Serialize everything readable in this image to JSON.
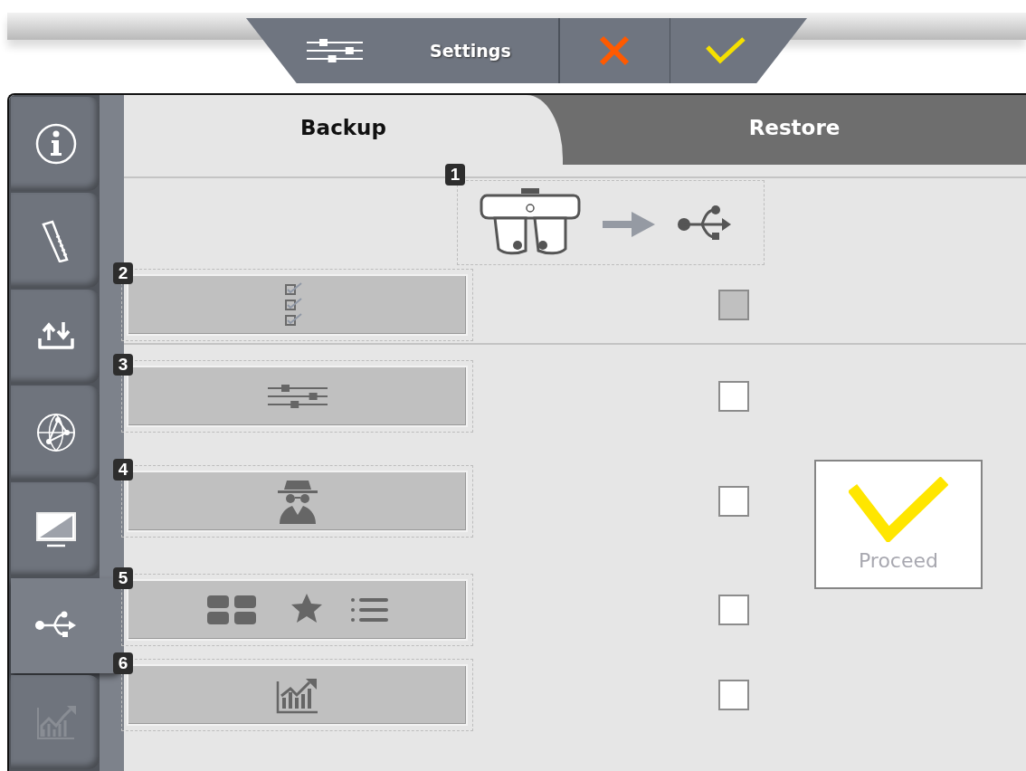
{
  "toolbar": {
    "buttons": [
      {
        "kind": "settings",
        "label": "Settings"
      },
      {
        "kind": "cancel"
      },
      {
        "kind": "confirm"
      }
    ]
  },
  "sidebar": {
    "items": [
      {
        "kind": "info",
        "selected": false,
        "disabled": false
      },
      {
        "kind": "ruler",
        "selected": false,
        "disabled": false
      },
      {
        "kind": "transfer",
        "selected": false,
        "disabled": false
      },
      {
        "kind": "network",
        "selected": false,
        "disabled": false
      },
      {
        "kind": "display",
        "selected": false,
        "disabled": false
      },
      {
        "kind": "usb",
        "selected": true,
        "disabled": false
      },
      {
        "kind": "chart",
        "selected": false,
        "disabled": true
      }
    ]
  },
  "tabs": [
    {
      "label": "Backup",
      "selected": true
    },
    {
      "label": "Restore",
      "selected": false
    }
  ],
  "header": {
    "number": "1"
  },
  "options": [
    {
      "number": "2",
      "kind": "checklist",
      "checked": false,
      "disabled": true
    },
    {
      "number": "3",
      "kind": "sliders",
      "checked": false,
      "disabled": false
    },
    {
      "number": "4",
      "kind": "incognito",
      "checked": false,
      "disabled": false
    },
    {
      "number": "5",
      "kind": "layouts",
      "checked": false,
      "disabled": false
    },
    {
      "number": "6",
      "kind": "statistics",
      "checked": false,
      "disabled": false
    }
  ],
  "proceed": {
    "label": "Proceed"
  }
}
